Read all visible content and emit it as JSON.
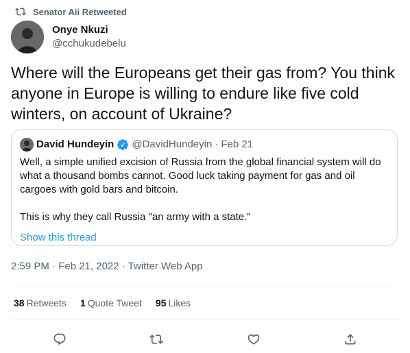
{
  "retweeted_by": "Senator Aii Retweeted",
  "author": {
    "display_name": "Onye Nkuzi",
    "handle": "@cchukudebelu"
  },
  "tweet_text": "Where will the Europeans get their gas from? You think anyone in Europe is willing to endure like five cold winters, on account of Ukraine?",
  "quoted_tweet": {
    "display_name": "David Hundeyin",
    "handle": "@DavidHundeyin",
    "separator": "·",
    "date": "Feb 21",
    "text": "Well, a simple unified excision of Russia from the global financial system will do what a thousand bombs cannot. Good luck taking payment for gas and oil cargoes with gold bars and bitcoin.\n\nThis is why they call Russia \"an army with a state.\"",
    "show_thread": "Show this thread"
  },
  "timestamp": "2:59 PM · Feb 21, 2022 · Twitter Web App",
  "stats": {
    "retweets_count": "38",
    "retweets_label": "Retweets",
    "quotes_count": "1",
    "quotes_label": "Quote Tweet",
    "likes_count": "95",
    "likes_label": "Likes"
  },
  "icons": {
    "retweet": "retweet-icon",
    "verified": "verified-badge-icon",
    "reply": "reply-icon",
    "like": "heart-icon",
    "share": "share-icon"
  },
  "colors": {
    "accent": "#1d9bf0",
    "muted": "#536471",
    "text": "#0f1419",
    "border": "#cfd9de"
  }
}
